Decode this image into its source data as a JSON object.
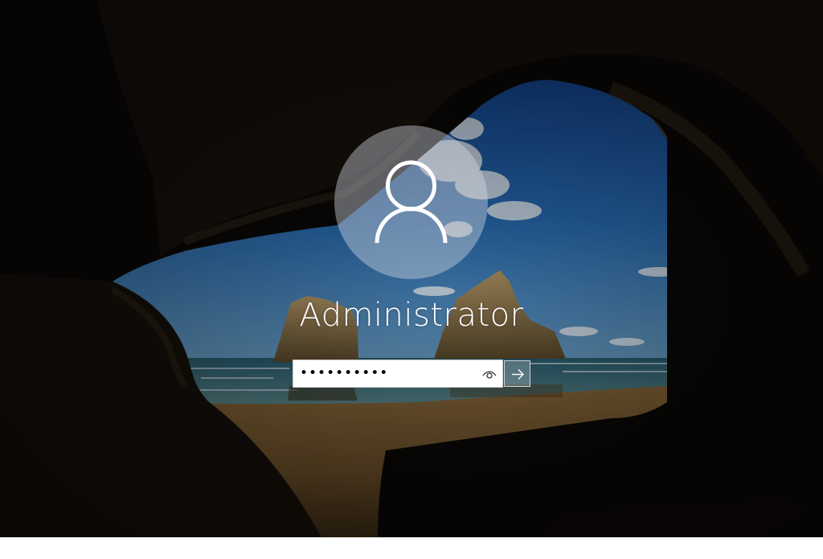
{
  "login": {
    "username": "Administrator",
    "password_masked": "••••••••••"
  },
  "icons": {
    "avatar": "user-silhouette-icon",
    "reveal": "eye-icon",
    "submit": "arrow-right-icon"
  },
  "colors": {
    "sky": "#1f5fae",
    "sea": "#2f6a7c",
    "sand": "#8a6b3a",
    "cave": "#0a0806",
    "text": "#ffffff"
  }
}
